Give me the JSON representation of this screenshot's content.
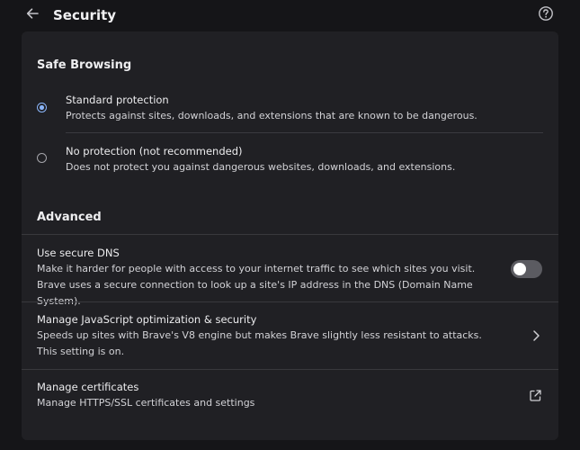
{
  "header": {
    "title": "Security",
    "back_icon": "arrow-left-icon",
    "help_icon": "help-circle-icon"
  },
  "safe_browsing": {
    "section_title": "Safe Browsing",
    "options": [
      {
        "title": "Standard protection",
        "description": "Protects against sites, downloads, and extensions that are known to be dangerous.",
        "selected": true
      },
      {
        "title": "No protection (not recommended)",
        "description": "Does not protect you against dangerous websites, downloads, and extensions.",
        "selected": false
      }
    ]
  },
  "advanced": {
    "section_title": "Advanced",
    "secure_dns": {
      "title": "Use secure DNS",
      "description": "Make it harder for people with access to your internet traffic to see which sites you visit. Brave uses a secure connection to look up a site's IP address in the DNS (Domain Name System).",
      "enabled": false
    },
    "js_optimization": {
      "title": "Manage JavaScript optimization & security",
      "description": "Speeds up sites with Brave's V8 engine but makes Brave slightly less resistant to attacks. This setting is on.",
      "icon": "chevron-right-icon"
    },
    "certificates": {
      "title": "Manage certificates",
      "description": "Manage HTTPS/SSL certificates and settings",
      "icon": "external-link-icon"
    }
  },
  "colors": {
    "background": "#151518",
    "card": "#202024",
    "accent": "#8ab4f8",
    "toggle_off": "#5b5b61"
  }
}
